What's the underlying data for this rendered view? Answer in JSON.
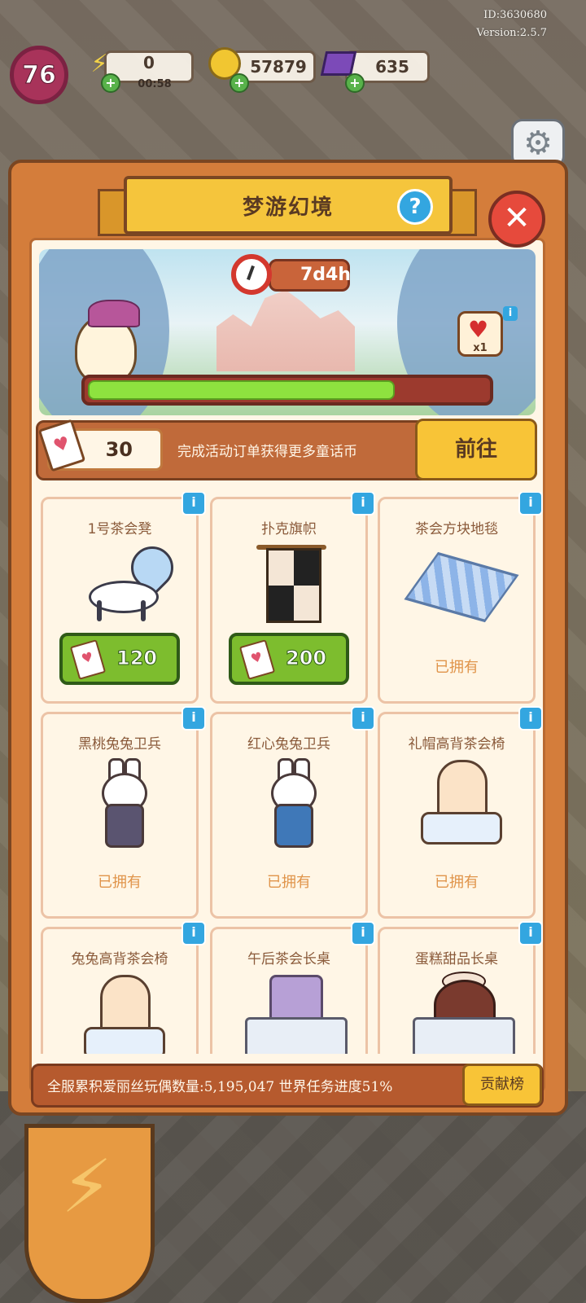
{
  "hud": {
    "player_id": "ID:3630680",
    "version": "Version:2.5.7",
    "level": "76",
    "energy": "0",
    "energy_timer": "00:58",
    "coins": "57879",
    "gems": "635"
  },
  "panel": {
    "title": "梦游幻境",
    "help": "?",
    "close": "✕",
    "timer": "7d4h",
    "progress_fraction": 0.77,
    "reward_qty": "x1",
    "currency_amount": "30",
    "currency_desc": "完成活动订单获得更多童话币",
    "goto_label": "前往"
  },
  "items": [
    {
      "name": "1号茶会凳",
      "status": "price",
      "price": "120"
    },
    {
      "name": "扑克旗帜",
      "status": "price",
      "price": "200"
    },
    {
      "name": "茶会方块地毯",
      "status": "owned",
      "owned_label": "已拥有"
    },
    {
      "name": "黑桃兔兔卫兵",
      "status": "owned",
      "owned_label": "已拥有"
    },
    {
      "name": "红心兔兔卫兵",
      "status": "owned",
      "owned_label": "已拥有"
    },
    {
      "name": "礼帽高背茶会椅",
      "status": "owned",
      "owned_label": "已拥有"
    },
    {
      "name": "兔兔高背茶会椅",
      "status": "partial"
    },
    {
      "name": "午后茶会长桌",
      "status": "partial"
    },
    {
      "name": "蛋糕甜品长桌",
      "status": "partial"
    }
  ],
  "world": {
    "text": "全服累积爱丽丝玩偶数量:5,195,047 世界任务进度51%",
    "rank_label": "贡献榜"
  },
  "icons": {
    "info": "i",
    "heart_card": "♥",
    "gear": "⚙",
    "bolt": "⚡"
  },
  "colors": {
    "panel_orange": "#d47d3b",
    "title_yellow": "#f5c53c",
    "buy_green": "#7dbd2e",
    "progress_green": "#8ee23f",
    "info_blue": "#33a6e0",
    "close_red": "#e64a3c"
  }
}
